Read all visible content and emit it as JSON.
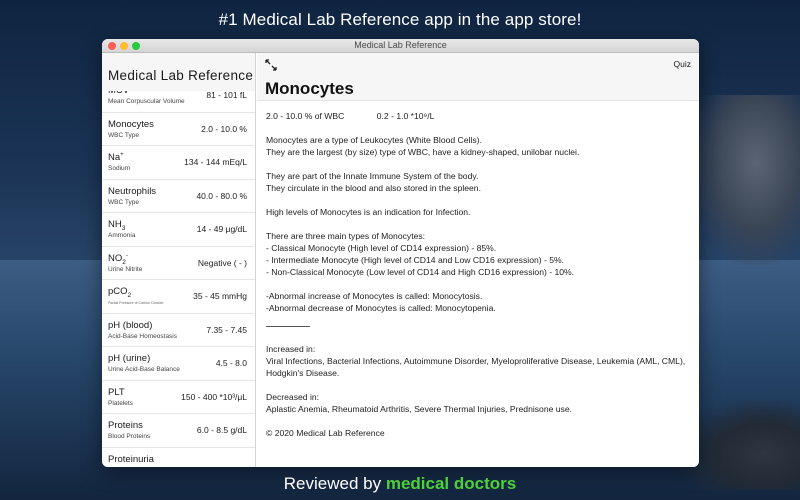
{
  "promo": {
    "top": "#1 Medical Lab Reference app in the app store!",
    "bottom_prefix": "Reviewed by ",
    "bottom_highlight": "medical doctors"
  },
  "window": {
    "title": "Medical Lab Reference"
  },
  "sidebar": {
    "title": "Medical Lab Reference",
    "items": [
      {
        "name": "MCV",
        "sub": "Mean Corpuscular Volume",
        "value": "81 - 101 fL"
      },
      {
        "name": "Monocytes",
        "sub": "WBC Type",
        "value": "2.0 - 10.0 %"
      },
      {
        "name": "Na",
        "sup": "+",
        "sub": "Sodium",
        "value": "134 - 144 mEq/L"
      },
      {
        "name": "Neutrophils",
        "sub": "WBC Type",
        "value": "40.0 - 80.0 %"
      },
      {
        "name": "NH",
        "subscript": "3",
        "sub": "Ammonia",
        "value": "14 - 49 μg/dL"
      },
      {
        "name": "NO",
        "subscript": "2",
        "sup": "-",
        "sub": "Urine Nitrite",
        "value": "Negative ( - )"
      },
      {
        "name": "pCO",
        "subscript": "2",
        "sub": "Partial Pressure of Carbon Dioxide",
        "value": "35 - 45 mmHg"
      },
      {
        "name": "pH (blood)",
        "sub": "Acid-Base Homeostasis",
        "value": "7.35 - 7.45"
      },
      {
        "name": "pH (urine)",
        "sub": "Urine Acid-Base Balance",
        "value": "4.5 - 8.0"
      },
      {
        "name": "PLT",
        "sub": "Platelets",
        "value": "150 - 400 *10³/μL"
      },
      {
        "name": "Proteins",
        "sub": "Blood Proteins",
        "value": "6.0 - 8.5 g/dL"
      },
      {
        "name": "Proteinuria",
        "sub": "",
        "value": ""
      }
    ]
  },
  "content": {
    "quiz_label": "Quiz",
    "expand_icon": "expand-arrows-icon",
    "title": "Monocytes",
    "range_percent": "2.0 - 10.0 % of WBC",
    "range_absolute": "0.2 - 1.0 *10⁹/L",
    "paragraphs": [
      [
        "Monocytes are a type of Leukocytes (White Blood Cells).",
        "They are the largest (by size) type of WBC, have a kidney-shaped, unilobar nuclei."
      ],
      [
        "They are part of the Innate Immune System of the body.",
        "They circulate in the blood and also stored in the spleen."
      ],
      [
        "High levels of Monocytes is an indication for Infection."
      ],
      [
        "There are three main types of Monocytes:",
        "- Classical Monocyte (High level of CD14 expression) - 85%.",
        "- Intermediate Monocyte (High level of CD14 and Low CD16 expression) - 5%.",
        "- Non-Classical Monocyte (Low level of CD14 and High CD16 expression) - 10%."
      ],
      [
        "-Abnormal increase of Monocytes is called: Monocytosis.",
        "-Abnormal decrease of Monocytes is called: Monocytopenia."
      ]
    ],
    "increased_label": "Increased in:",
    "increased_text": "Viral Infections, Bacterial Infections, Autoimmune Disorder, Myeloproliferative Disease, Leukemia (AML, CML), Hodgkin's Disease.",
    "decreased_label": "Decreased in:",
    "decreased_text": "Aplastic Anemia, Rheumatoid Arthritis, Severe Thermal Injuries, Prednisone use.",
    "copyright": "© 2020 Medical Lab Reference"
  }
}
